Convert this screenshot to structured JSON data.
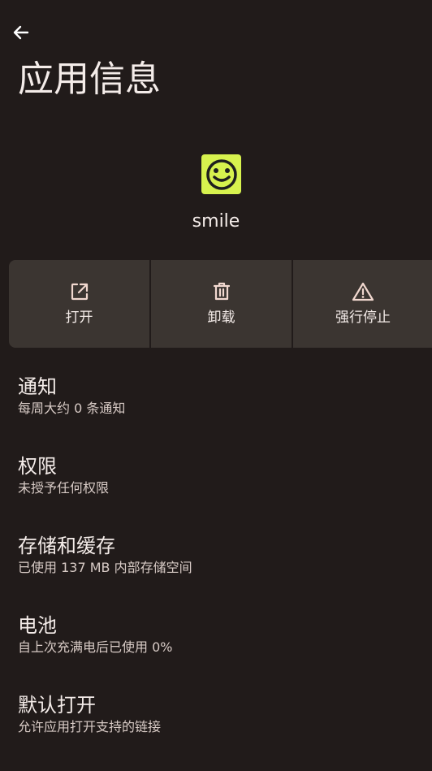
{
  "header": {
    "back_icon": "arrow-left-icon",
    "title": "应用信息"
  },
  "app": {
    "icon": "smile-face-icon",
    "icon_color": "#d7f24e",
    "name": "smile"
  },
  "actions": [
    {
      "label": "打开",
      "icon": "open-external-icon"
    },
    {
      "label": "卸载",
      "icon": "trash-icon"
    },
    {
      "label": "强行停止",
      "icon": "warning-icon"
    }
  ],
  "settings": [
    {
      "title": "通知",
      "subtitle": "每周大约 0 条通知"
    },
    {
      "title": "权限",
      "subtitle": "未授予任何权限"
    },
    {
      "title": "存储和缓存",
      "subtitle": "已使用 137 MB 内部存储空间"
    },
    {
      "title": "电池",
      "subtitle": "自上次充满电后已使用 0%"
    },
    {
      "title": "默认打开",
      "subtitle": "允许应用打开支持的链接"
    }
  ],
  "colors": {
    "background": "#211b1a",
    "action_background": "#3b3531",
    "accent_icon": "#f1d8cf"
  }
}
